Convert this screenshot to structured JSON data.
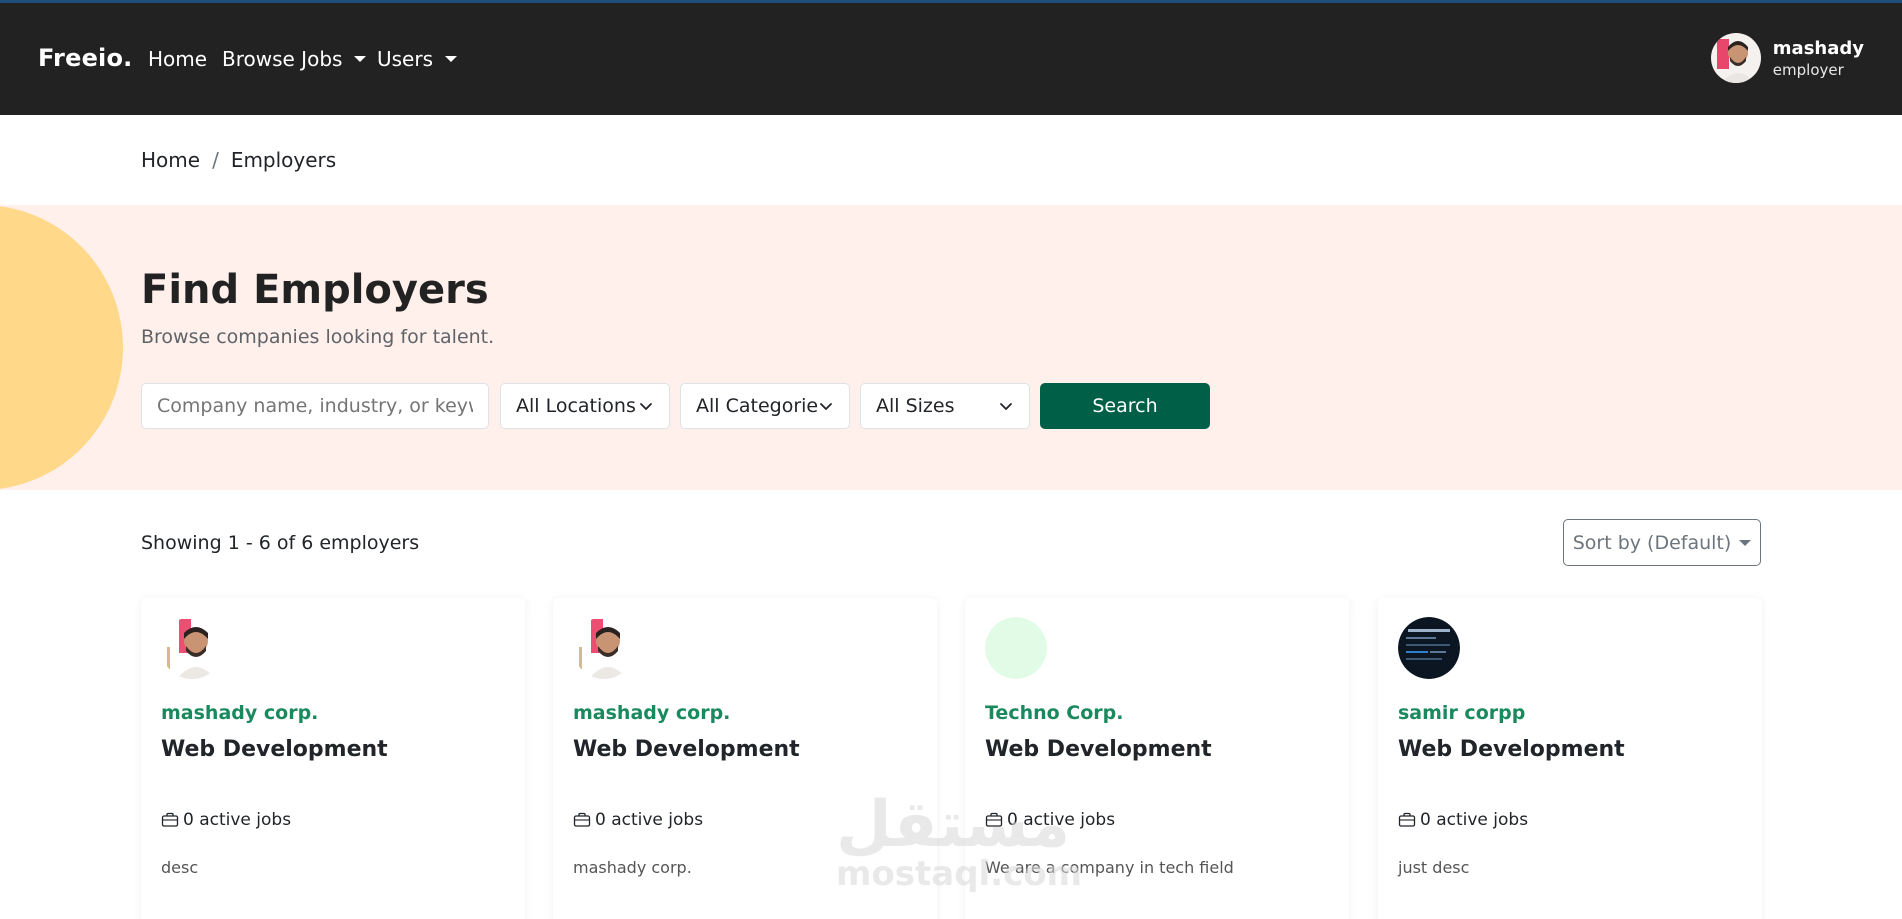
{
  "navbar": {
    "brand": "Freeio.",
    "links": [
      {
        "label": "Home"
      },
      {
        "label": "Browse Jobs"
      },
      {
        "label": "Users"
      }
    ],
    "user": {
      "name": "mashady",
      "role": "employer"
    }
  },
  "breadcrumb": {
    "home": "Home",
    "separator": "/",
    "current": "Employers"
  },
  "hero": {
    "title": "Find Employers",
    "subtitle": "Browse companies looking for talent.",
    "search_placeholder": "Company name, industry, or keywords",
    "filters": {
      "location": "All Locations",
      "category": "All Categories",
      "size": "All Sizes"
    },
    "search_button": "Search"
  },
  "results": {
    "showing": "Showing 1 - 6 of 6 employers",
    "sort_label": "Sort by (Default)"
  },
  "employers": [
    {
      "company": "mashady corp.",
      "category": "Web Development",
      "jobs": "0 active jobs",
      "desc": "desc",
      "logo": "person-photo"
    },
    {
      "company": "mashady corp.",
      "category": "Web Development",
      "jobs": "0 active jobs",
      "desc": "mashady corp.",
      "logo": "person-photo"
    },
    {
      "company": "Techno Corp.",
      "category": "Web Development",
      "jobs": "0 active jobs",
      "desc": "We are a company in tech field",
      "logo": "light-green-circle"
    },
    {
      "company": "samir corpp",
      "category": "Web Development",
      "jobs": "0 active jobs",
      "desc": "just desc",
      "logo": "dark-screenshot"
    }
  ],
  "watermark": {
    "arabic": "مستقل",
    "latin": "mostaql.com"
  },
  "colors": {
    "navbar_bg": "#222222",
    "hero_bg": "#fff0ec",
    "hero_accent": "#ffd88a",
    "primary_button": "#005f47",
    "company_link": "#1a8a5e"
  }
}
